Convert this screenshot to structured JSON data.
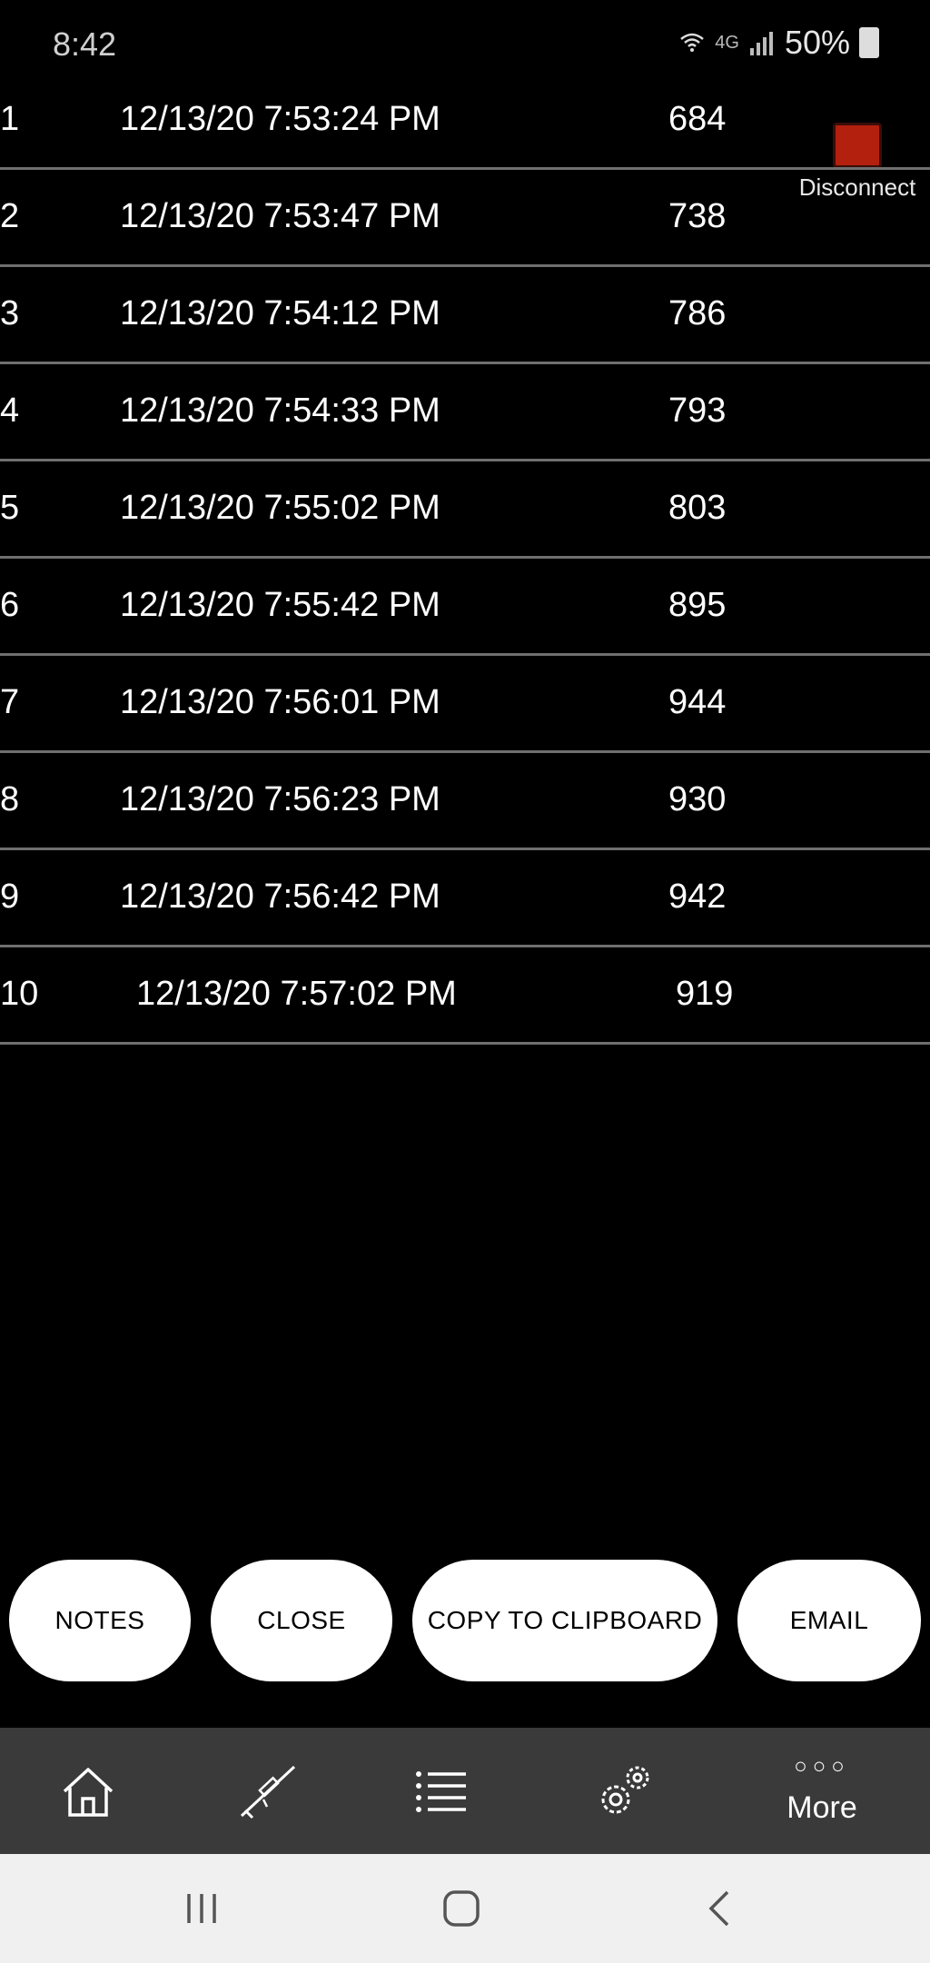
{
  "status_bar": {
    "time": "8:42",
    "network": "4G",
    "battery": "50%",
    "icons": [
      "wifi-icon",
      "signal-icon",
      "battery-icon"
    ]
  },
  "disconnect": {
    "label": "Disconnect",
    "color": "#b4200e"
  },
  "table": {
    "rows": [
      {
        "index": "1",
        "time": "12/13/20 7:53:24 PM",
        "value": "684"
      },
      {
        "index": "2",
        "time": "12/13/20 7:53:47 PM",
        "value": "738"
      },
      {
        "index": "3",
        "time": "12/13/20 7:54:12 PM",
        "value": "786"
      },
      {
        "index": "4",
        "time": "12/13/20 7:54:33 PM",
        "value": "793"
      },
      {
        "index": "5",
        "time": "12/13/20 7:55:02 PM",
        "value": "803"
      },
      {
        "index": "6",
        "time": "12/13/20 7:55:42 PM",
        "value": "895"
      },
      {
        "index": "7",
        "time": "12/13/20 7:56:01 PM",
        "value": "944"
      },
      {
        "index": "8",
        "time": "12/13/20 7:56:23 PM",
        "value": "930"
      },
      {
        "index": "9",
        "time": "12/13/20 7:56:42 PM",
        "value": "942"
      },
      {
        "index": "10",
        "time": "12/13/20 7:57:02 PM",
        "value": "919"
      }
    ]
  },
  "actions": {
    "notes": "NOTES",
    "close": "CLOSE",
    "copy": "COPY TO CLIPBOARD",
    "email": "EMAIL"
  },
  "tab_bar": {
    "icons": [
      "home-icon",
      "rifle-scope-icon",
      "list-icon",
      "gear-icon",
      "more-dots-icon"
    ],
    "more_dots": "○○○",
    "more_label": "More"
  },
  "nav_bar": {
    "icons": [
      "recent-apps-icon",
      "home-circle-icon",
      "back-icon"
    ]
  },
  "colors": {
    "background": "#000000",
    "pill": "#ffffff",
    "tab_bar": "#3a3a3a",
    "nav_bar": "#f0f0f0",
    "divider": "#6f6f6f"
  }
}
